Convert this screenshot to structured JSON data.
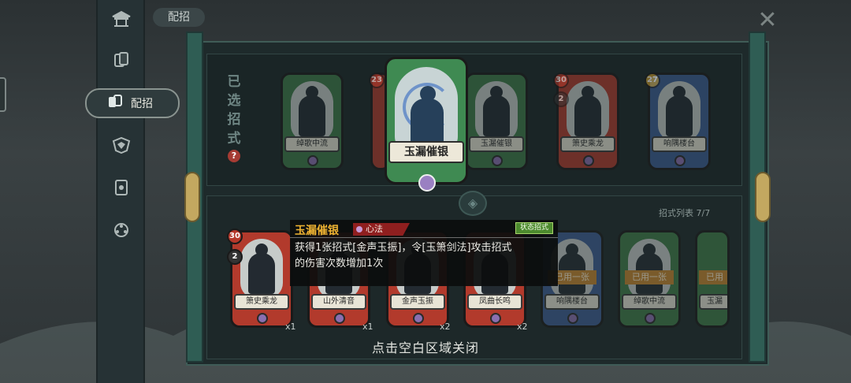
{
  "header": {
    "page_title": "配招",
    "close_icon": "close-icon"
  },
  "sidebar": {
    "items": [
      {
        "icon": "pavilion-icon"
      },
      {
        "icon": "cards-icon"
      },
      {
        "icon": "card-hand-icon",
        "label": "配招",
        "active": true
      },
      {
        "icon": "crest-icon"
      },
      {
        "icon": "card-icon"
      },
      {
        "icon": "compass-icon"
      }
    ]
  },
  "selected": {
    "label_chars": [
      "已",
      "选",
      "招",
      "式"
    ],
    "help": "?",
    "cards": [
      {
        "name": "绰歌中流",
        "color": "green",
        "cost": ""
      },
      {
        "name": "",
        "color": "red",
        "cost": "23"
      },
      {
        "name": "玉漏催银",
        "color": "green",
        "cost": "",
        "featured": true
      },
      {
        "name": "玉漏催银",
        "color": "green",
        "cost": ""
      },
      {
        "name": "箫史乘龙",
        "color": "red",
        "cost": "30",
        "badge": "2"
      },
      {
        "name": "响隅楼台",
        "color": "blue",
        "cost": "27"
      }
    ]
  },
  "featured": {
    "name": "玉漏催银"
  },
  "list": {
    "count_label": "招式列表 7/7",
    "cards": [
      {
        "name": "箫史乘龙",
        "color": "red",
        "cost": "30",
        "badge": "2",
        "qty": "x1"
      },
      {
        "name": "山外清音",
        "color": "red",
        "cost": "",
        "qty": "x1"
      },
      {
        "name": "金声玉振",
        "color": "red",
        "cost": "",
        "qty": "x2"
      },
      {
        "name": "凤曲长鸣",
        "color": "red",
        "cost": "",
        "qty": "x2"
      },
      {
        "name": "响隅楼台",
        "color": "blue",
        "cost": "",
        "used": "已用一张"
      },
      {
        "name": "绰歌中流",
        "color": "green",
        "cost": "",
        "used": "已用一张"
      },
      {
        "name": "玉漏",
        "color": "green",
        "cost": "",
        "used": "已用"
      }
    ]
  },
  "tooltip": {
    "title": "玉漏催银",
    "type": "心法",
    "tag": "状态招式",
    "desc_line1": "获得1张招式[金声玉振]，令[玉箫剑法]攻击招式",
    "desc_line2": "的伤害次数增加1次"
  },
  "hint": "点击空白区域关闭"
}
